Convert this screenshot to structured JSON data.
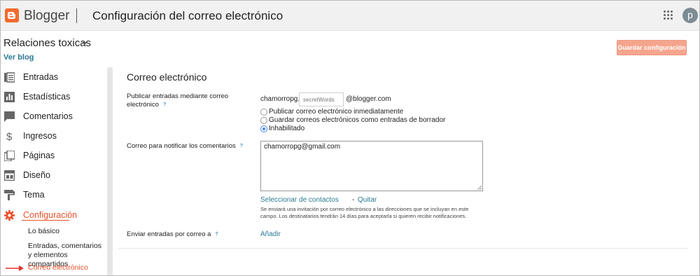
{
  "header": {
    "brand": "Blogger",
    "page_title": "Configuración del correo electrónico",
    "apps_icon": "apps-grid-icon",
    "avatar_initial": "p",
    "brand_color": "#f26a2e"
  },
  "blog": {
    "name": "Relaciones toxicas",
    "view_link": "Ver blog",
    "save_button": "Guardar configuración"
  },
  "sidebar": {
    "items": [
      {
        "label": "Entradas",
        "icon": "posts-icon"
      },
      {
        "label": "Estadísticas",
        "icon": "stats-icon"
      },
      {
        "label": "Comentarios",
        "icon": "comments-icon"
      },
      {
        "label": "Ingresos",
        "icon": "dollar-icon"
      },
      {
        "label": "Páginas",
        "icon": "pages-icon"
      },
      {
        "label": "Diseño",
        "icon": "layout-icon"
      },
      {
        "label": "Tema",
        "icon": "theme-icon"
      },
      {
        "label": "Configuración",
        "icon": "gear-icon"
      }
    ],
    "active": "Configuración",
    "subitems": [
      {
        "label": "Lo básico"
      },
      {
        "label": "Entradas, comentarios y elementos compartidos"
      },
      {
        "label": "Correo electrónico"
      }
    ],
    "active_color": "#e8512c"
  },
  "main": {
    "section_title": "Correo electrónico",
    "post_by_email": {
      "label": "Publicar entradas mediante correo electrónico",
      "help": "?",
      "prefix": "chamorropg.",
      "placeholder": "secretWords",
      "suffix": "@blogger.com",
      "options": [
        "Publicar correo electrónico inmediatamente",
        "Guardar correos electrónicos como entradas de borrador",
        "Inhabilitado"
      ],
      "selected": "Inhabilitado"
    },
    "comment_notify": {
      "label": "Correo para notificar los comentarios",
      "help": "?",
      "value": "chamorropg@gmail.com",
      "select_contacts": "Seleccionar de contactos",
      "separator": "-",
      "remove": "Quitar",
      "note": "Se enviará una invitación por correo electrónico a las direcciones que se incluyan en este campo. Los destinatarios tendrán 14 días para aceptarla si quieren recibir notificaciones."
    },
    "email_posts_to": {
      "label": "Enviar entradas por correo a",
      "help": "?",
      "add": "Añadir"
    }
  }
}
